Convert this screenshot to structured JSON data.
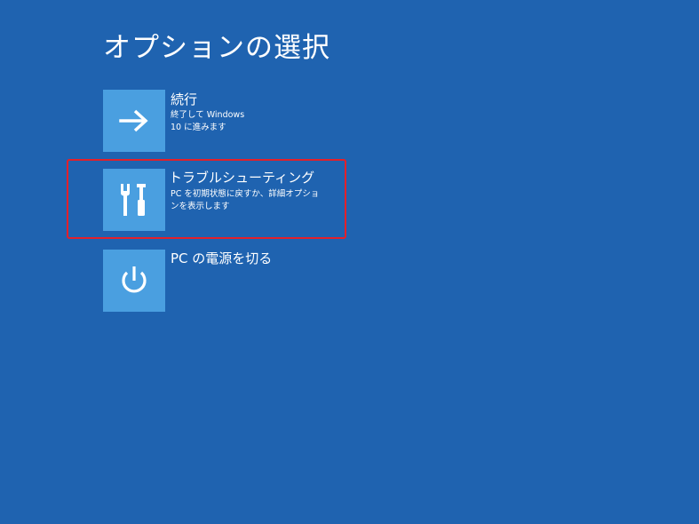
{
  "screen": {
    "title": "オプションの選択"
  },
  "options": [
    {
      "label": "続行",
      "description": "終了して Windows 10 に進みます",
      "icon": "arrow-right-icon"
    },
    {
      "label": "トラブルシューティング",
      "description": "PC を初期状態に戻すか、詳細オプションを表示します",
      "icon": "tools-icon"
    },
    {
      "label": "PC の電源を切る",
      "icon": "power-icon"
    }
  ],
  "colors": {
    "background": "#1f63b0",
    "tile": "#4a9fe0",
    "highlight": "#e3202a",
    "text": "#ffffff"
  }
}
